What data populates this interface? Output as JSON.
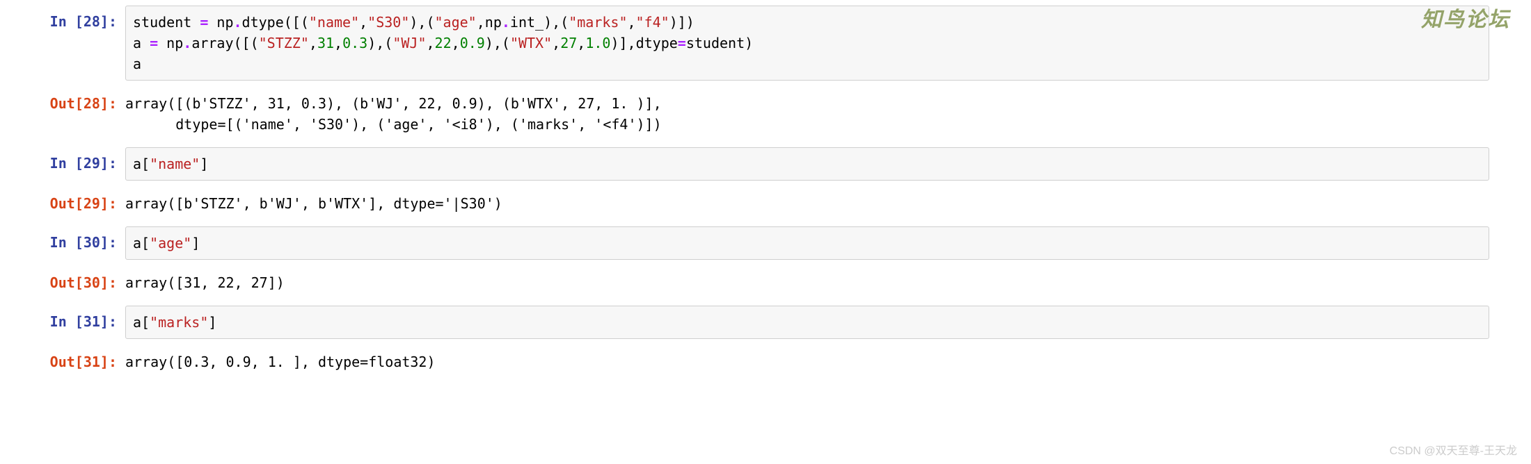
{
  "watermark_top": "知鸟论坛",
  "watermark_bottom": "CSDN @双天至尊-王天龙",
  "cells": [
    {
      "prompt_in": "In [28]:",
      "prompt_out": "Out[28]:",
      "code_lines": [
        [
          {
            "t": "student ",
            "c": "tk-name"
          },
          {
            "t": "=",
            "c": "tk-op"
          },
          {
            "t": " np",
            "c": "tk-name"
          },
          {
            "t": ".",
            "c": "tk-op"
          },
          {
            "t": "dtype([(",
            "c": "tk-name"
          },
          {
            "t": "\"name\"",
            "c": "tk-s"
          },
          {
            "t": ",",
            "c": "tk-p"
          },
          {
            "t": "\"S30\"",
            "c": "tk-s"
          },
          {
            "t": "),(",
            "c": "tk-p"
          },
          {
            "t": "\"age\"",
            "c": "tk-s"
          },
          {
            "t": ",np",
            "c": "tk-name"
          },
          {
            "t": ".",
            "c": "tk-op"
          },
          {
            "t": "int_),(",
            "c": "tk-name"
          },
          {
            "t": "\"marks\"",
            "c": "tk-s"
          },
          {
            "t": ",",
            "c": "tk-p"
          },
          {
            "t": "\"f4\"",
            "c": "tk-s"
          },
          {
            "t": ")])",
            "c": "tk-p"
          }
        ],
        [
          {
            "t": "a ",
            "c": "tk-name"
          },
          {
            "t": "=",
            "c": "tk-op"
          },
          {
            "t": " np",
            "c": "tk-name"
          },
          {
            "t": ".",
            "c": "tk-op"
          },
          {
            "t": "array([(",
            "c": "tk-name"
          },
          {
            "t": "\"STZZ\"",
            "c": "tk-s"
          },
          {
            "t": ",",
            "c": "tk-p"
          },
          {
            "t": "31",
            "c": "tk-n"
          },
          {
            "t": ",",
            "c": "tk-p"
          },
          {
            "t": "0.3",
            "c": "tk-n"
          },
          {
            "t": "),(",
            "c": "tk-p"
          },
          {
            "t": "\"WJ\"",
            "c": "tk-s"
          },
          {
            "t": ",",
            "c": "tk-p"
          },
          {
            "t": "22",
            "c": "tk-n"
          },
          {
            "t": ",",
            "c": "tk-p"
          },
          {
            "t": "0.9",
            "c": "tk-n"
          },
          {
            "t": "),(",
            "c": "tk-p"
          },
          {
            "t": "\"WTX\"",
            "c": "tk-s"
          },
          {
            "t": ",",
            "c": "tk-p"
          },
          {
            "t": "27",
            "c": "tk-n"
          },
          {
            "t": ",",
            "c": "tk-p"
          },
          {
            "t": "1.0",
            "c": "tk-n"
          },
          {
            "t": ")],dtype",
            "c": "tk-name"
          },
          {
            "t": "=",
            "c": "tk-op"
          },
          {
            "t": "student)",
            "c": "tk-name"
          }
        ],
        [
          {
            "t": "a",
            "c": "tk-name"
          }
        ]
      ],
      "output": "array([(b'STZZ', 31, 0.3), (b'WJ', 22, 0.9), (b'WTX', 27, 1. )],\n      dtype=[('name', 'S30'), ('age', '<i8'), ('marks', '<f4')])"
    },
    {
      "prompt_in": "In [29]:",
      "prompt_out": "Out[29]:",
      "code_lines": [
        [
          {
            "t": "a[",
            "c": "tk-name"
          },
          {
            "t": "\"name\"",
            "c": "tk-s"
          },
          {
            "t": "]",
            "c": "tk-p"
          }
        ]
      ],
      "output": "array([b'STZZ', b'WJ', b'WTX'], dtype='|S30')"
    },
    {
      "prompt_in": "In [30]:",
      "prompt_out": "Out[30]:",
      "code_lines": [
        [
          {
            "t": "a[",
            "c": "tk-name"
          },
          {
            "t": "\"age\"",
            "c": "tk-s"
          },
          {
            "t": "]",
            "c": "tk-p"
          }
        ]
      ],
      "output": "array([31, 22, 27])"
    },
    {
      "prompt_in": "In [31]:",
      "prompt_out": "Out[31]:",
      "code_lines": [
        [
          {
            "t": "a[",
            "c": "tk-name"
          },
          {
            "t": "\"marks\"",
            "c": "tk-s"
          },
          {
            "t": "]",
            "c": "tk-p"
          }
        ]
      ],
      "output": "array([0.3, 0.9, 1. ], dtype=float32)"
    }
  ]
}
